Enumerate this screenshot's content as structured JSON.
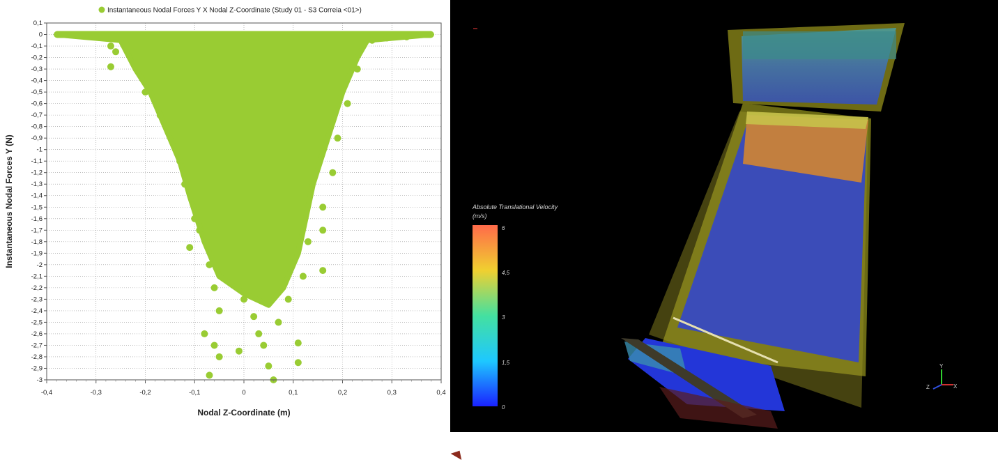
{
  "chart_data": {
    "type": "scatter",
    "legend": "Instantaneous Nodal Forces Y X Nodal Z-Coordinate (Study 01 - S3 Correia <01>)",
    "xlabel": "Nodal Z-Coordinate (m)",
    "ylabel": "Instantaneous Nodal Forces Y (N)",
    "xlim": [
      -0.4,
      0.4
    ],
    "ylim": [
      -3.0,
      0.1
    ],
    "x_ticks": [
      "-0,4",
      "-0,3",
      "-0,2",
      "-0,1",
      "0",
      "0,1",
      "0,2",
      "0,3",
      "0,4"
    ],
    "y_ticks": [
      "0,1",
      "0",
      "-0,1",
      "-0,2",
      "-0,3",
      "-0,4",
      "-0,5",
      "-0,6",
      "-0,7",
      "-0,8",
      "-0,9",
      "-1",
      "-1,1",
      "-1,2",
      "-1,3",
      "-1,4",
      "-1,5",
      "-1,6",
      "-1,7",
      "-1,8",
      "-1,9",
      "-2",
      "-2,1",
      "-2,2",
      "-2,3",
      "-2,4",
      "-2,5",
      "-2,6",
      "-2,7",
      "-2,8",
      "-2,9",
      "-3"
    ],
    "grid": true,
    "legend_placement": "top",
    "color": "#99cc33",
    "envelope": [
      {
        "x": -0.38,
        "y": 0.0
      },
      {
        "x": -0.25,
        "y": -0.05
      },
      {
        "x": -0.22,
        "y": -0.3
      },
      {
        "x": -0.19,
        "y": -0.5
      },
      {
        "x": -0.15,
        "y": -0.9
      },
      {
        "x": -0.13,
        "y": -1.1
      },
      {
        "x": -0.11,
        "y": -1.4
      },
      {
        "x": -0.08,
        "y": -1.8
      },
      {
        "x": -0.05,
        "y": -2.1
      },
      {
        "x": 0.0,
        "y": -2.25
      },
      {
        "x": 0.05,
        "y": -2.35
      },
      {
        "x": 0.08,
        "y": -2.2
      },
      {
        "x": 0.11,
        "y": -1.9
      },
      {
        "x": 0.14,
        "y": -1.3
      },
      {
        "x": 0.17,
        "y": -0.9
      },
      {
        "x": 0.2,
        "y": -0.5
      },
      {
        "x": 0.23,
        "y": -0.2
      },
      {
        "x": 0.25,
        "y": -0.05
      },
      {
        "x": 0.38,
        "y": 0.0
      }
    ],
    "outliers": [
      {
        "x": -0.27,
        "y": -0.1
      },
      {
        "x": -0.27,
        "y": -0.28
      },
      {
        "x": -0.26,
        "y": -0.15
      },
      {
        "x": -0.24,
        "y": -0.08
      },
      {
        "x": -0.2,
        "y": -0.5
      },
      {
        "x": -0.17,
        "y": -0.7
      },
      {
        "x": -0.13,
        "y": -1.1
      },
      {
        "x": -0.12,
        "y": -1.3
      },
      {
        "x": -0.1,
        "y": -1.6
      },
      {
        "x": -0.09,
        "y": -1.7
      },
      {
        "x": -0.11,
        "y": -1.85
      },
      {
        "x": -0.07,
        "y": -2.0
      },
      {
        "x": -0.06,
        "y": -2.2
      },
      {
        "x": -0.05,
        "y": -2.4
      },
      {
        "x": -0.08,
        "y": -2.6
      },
      {
        "x": -0.06,
        "y": -2.7
      },
      {
        "x": -0.05,
        "y": -2.8
      },
      {
        "x": -0.07,
        "y": -2.96
      },
      {
        "x": -0.01,
        "y": -2.75
      },
      {
        "x": 0.0,
        "y": -2.3
      },
      {
        "x": 0.02,
        "y": -2.45
      },
      {
        "x": 0.03,
        "y": -2.6
      },
      {
        "x": 0.04,
        "y": -2.7
      },
      {
        "x": 0.05,
        "y": -2.88
      },
      {
        "x": 0.06,
        "y": -3.0
      },
      {
        "x": 0.07,
        "y": -2.5
      },
      {
        "x": 0.09,
        "y": -2.3
      },
      {
        "x": 0.11,
        "y": -2.68
      },
      {
        "x": 0.11,
        "y": -2.85
      },
      {
        "x": 0.12,
        "y": -2.1
      },
      {
        "x": 0.13,
        "y": -1.8
      },
      {
        "x": 0.16,
        "y": -2.05
      },
      {
        "x": 0.16,
        "y": -1.5
      },
      {
        "x": 0.16,
        "y": -1.7
      },
      {
        "x": 0.18,
        "y": -1.2
      },
      {
        "x": 0.19,
        "y": -0.9
      },
      {
        "x": 0.21,
        "y": -0.6
      },
      {
        "x": 0.23,
        "y": -0.3
      },
      {
        "x": 0.26,
        "y": -0.05
      },
      {
        "x": 0.29,
        "y": -0.03
      },
      {
        "x": 0.33,
        "y": -0.02
      }
    ]
  },
  "viewer": {
    "legend_title_line1": "Absolute Translational Velocity",
    "legend_title_line2": "(m/s)",
    "legend_ticks": [
      "6",
      "4,5",
      "3",
      "1,5",
      "0"
    ],
    "triad": {
      "y": "Y",
      "x": "X",
      "z": "Z"
    }
  }
}
